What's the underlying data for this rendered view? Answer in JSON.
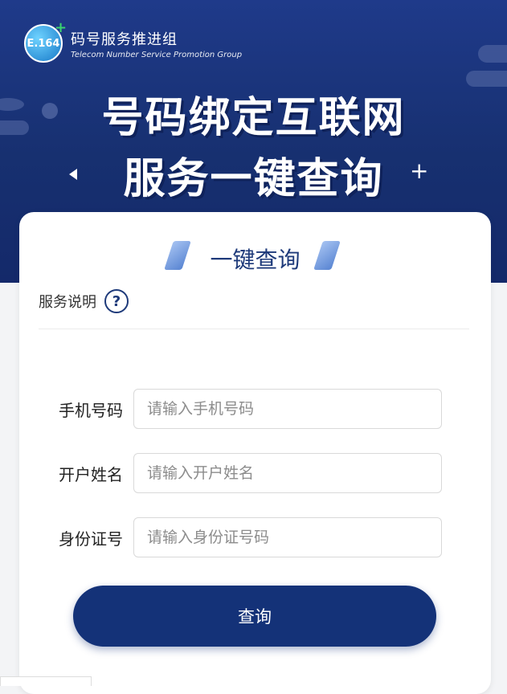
{
  "banner": {
    "logo_badge": "E.164",
    "logo_plus": "+",
    "org_name_cn": "码号服务推进组",
    "org_name_en": "Telecom Number Service Promotion Group",
    "headline_line1": "号码绑定互联网",
    "headline_line2": "服务一键查询",
    "background_color": "#1f3a8a"
  },
  "card": {
    "title": "一键查询",
    "service_label": "服务说明",
    "help_icon": "question-circle-icon",
    "help_glyph": "?"
  },
  "form": {
    "fields": [
      {
        "label": "手机号码",
        "placeholder": "请输入手机号码",
        "value": ""
      },
      {
        "label": "开户姓名",
        "placeholder": "请输入开户姓名",
        "value": ""
      },
      {
        "label": "身份证号",
        "placeholder": "请输入身份证号码",
        "value": ""
      }
    ],
    "submit_label": "查询",
    "accent_color": "#143278"
  }
}
